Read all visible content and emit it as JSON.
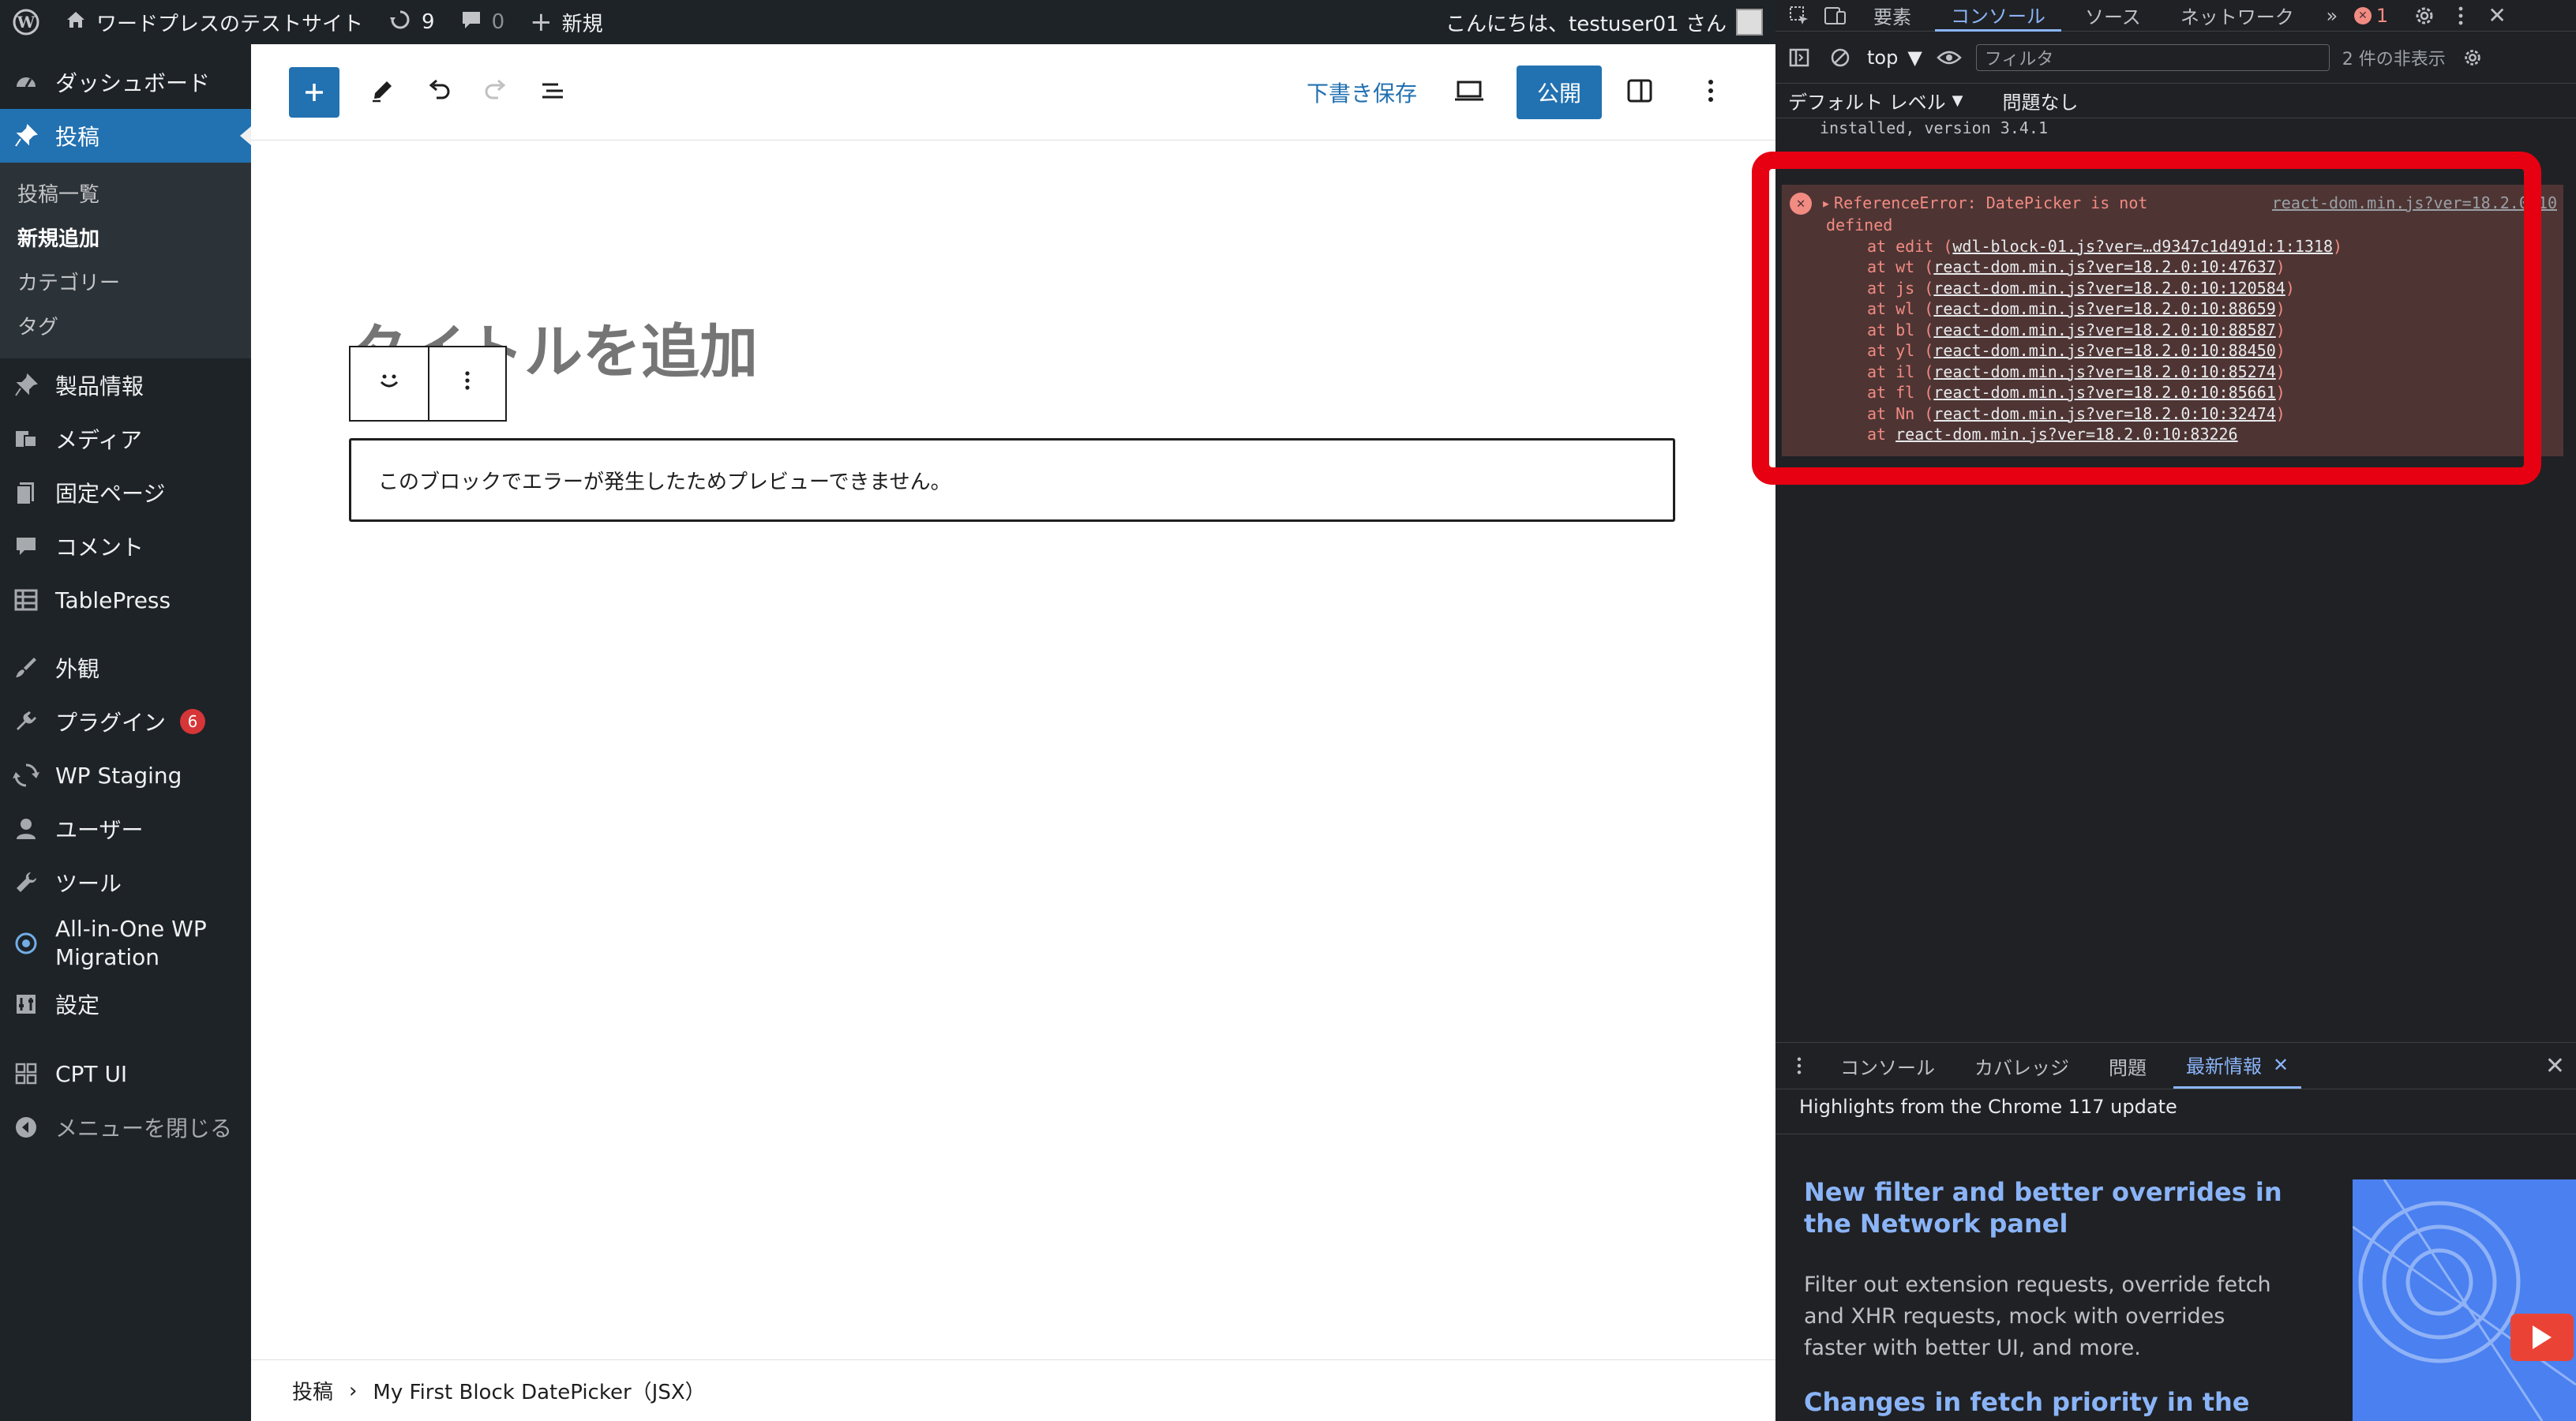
{
  "adminbar": {
    "site_name": "ワードプレスのテストサイト",
    "updates_count": "9",
    "comments_count": "0",
    "new_label": "新規",
    "greeting": "こんにちは、testuser01 さん"
  },
  "sidebar": {
    "dashboard": "ダッシュボード",
    "posts": "投稿",
    "posts_sub": [
      "投稿一覧",
      "新規追加",
      "カテゴリー",
      "タグ"
    ],
    "product_info": "製品情報",
    "media": "メディア",
    "pages": "固定ページ",
    "comments": "コメント",
    "tablepress": "TablePress",
    "appearance": "外観",
    "plugins": "プラグイン",
    "plugins_badge": "6",
    "wp_staging": "WP Staging",
    "users": "ユーザー",
    "tools": "ツール",
    "aio_migration": "All-in-One WP Migration",
    "settings": "設定",
    "cpt_ui": "CPT UI",
    "collapse": "メニューを閉じる"
  },
  "editor": {
    "draft_save": "下書き保存",
    "publish": "公開",
    "title_placeholder": "タイトルを追加",
    "error_message": "このブロックでエラーが発生したためプレビューできません。",
    "breadcrumb_root": "投稿",
    "breadcrumb_block": "My First Block DatePicker（JSX）"
  },
  "devtools": {
    "tabs": [
      "要素",
      "コンソール",
      "ソース",
      "ネットワーク"
    ],
    "active_tab": "コンソール",
    "error_count": "1",
    "context": "top",
    "filter_placeholder": "フィルタ",
    "hidden_count": "2 件の非表示",
    "default_levels": "デフォルト レベル",
    "no_issues": "問題なし",
    "installed_line": "installed, version 3.4.1",
    "error": {
      "message_line1": "ReferenceError: DatePicker is not",
      "message_line2": "defined",
      "source": "react-dom.min.js?ver=18.2.0:10",
      "stack": [
        {
          "prefix": "at edit (",
          "link": "wdl-block-01.js?ver=…d9347c1d491d:1:1318",
          "suffix": ")"
        },
        {
          "prefix": "at wt (",
          "link": "react-dom.min.js?ver=18.2.0:10:47637",
          "suffix": ")"
        },
        {
          "prefix": "at js (",
          "link": "react-dom.min.js?ver=18.2.0:10:120584",
          "suffix": ")"
        },
        {
          "prefix": "at wl (",
          "link": "react-dom.min.js?ver=18.2.0:10:88659",
          "suffix": ")"
        },
        {
          "prefix": "at bl (",
          "link": "react-dom.min.js?ver=18.2.0:10:88587",
          "suffix": ")"
        },
        {
          "prefix": "at yl (",
          "link": "react-dom.min.js?ver=18.2.0:10:88450",
          "suffix": ")"
        },
        {
          "prefix": "at il (",
          "link": "react-dom.min.js?ver=18.2.0:10:85274",
          "suffix": ")"
        },
        {
          "prefix": "at fl (",
          "link": "react-dom.min.js?ver=18.2.0:10:85661",
          "suffix": ")"
        },
        {
          "prefix": "at Nn (",
          "link": "react-dom.min.js?ver=18.2.0:10:32474",
          "suffix": ")"
        },
        {
          "prefix": "at ",
          "link": "react-dom.min.js?ver=18.2.0:10:83226",
          "suffix": ""
        }
      ]
    },
    "drawer_tabs": [
      "コンソール",
      "カバレッジ",
      "問題",
      "最新情報"
    ],
    "whats_new_heading": "Highlights from the Chrome 117 update",
    "article1_title": "New filter and better overrides in the Network panel",
    "article1_desc": "Filter out extension requests, override fetch and XHR requests, mock with overrides faster with better UI, and more.",
    "article2_title": "Changes in fetch priority in the"
  },
  "colors": {
    "wp_blue": "#2271b1",
    "admin_dark": "#1d2327",
    "devtools_bg": "#202124",
    "error_red": "#f28b82",
    "highlight_red": "#e60012",
    "link_blue": "#8ab4f8"
  }
}
